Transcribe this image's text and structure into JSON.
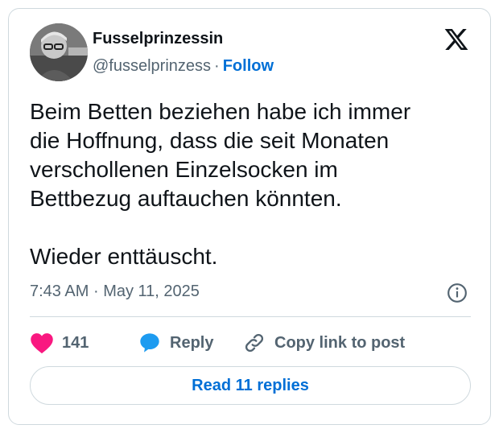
{
  "tweet": {
    "author": {
      "display_name": "Fusselprinzessin",
      "handle": "@fusselprinzess",
      "separator": "·",
      "follow_label": "Follow",
      "avatar_icon": "profile-photo"
    },
    "brand_icon": "x-logo-icon",
    "text": "Beim Betten beziehen habe ich immer\ndie Hoffnung, dass die seit Monaten\nverschollenen Einzelsocken im\nBettbezug auftauchen könnten.\n\nWieder enttäuscht.",
    "time": "7:43 AM",
    "date_separator": "·",
    "date": "May 11, 2025",
    "info_icon": "info-icon",
    "actions": {
      "like_count": "141",
      "like_icon": "heart-icon",
      "reply_label": "Reply",
      "reply_icon": "speech-bubble-icon",
      "copy_label": "Copy link to post",
      "copy_icon": "link-icon"
    },
    "read_replies_label": "Read 11 replies"
  },
  "colors": {
    "like": "#f91880",
    "reply": "#1d9bf0",
    "link_accent": "#006fd6",
    "muted": "#536471",
    "border": "#cfd9de"
  }
}
